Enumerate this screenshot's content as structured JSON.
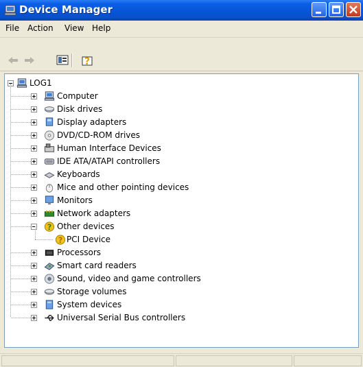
{
  "window": {
    "title": "Device Manager",
    "colors": {
      "titlebar": "#0a5fe8",
      "close": "#c3381f",
      "selection": "#316ac5"
    }
  },
  "menu": {
    "file": "File",
    "action": "Action",
    "view": "View",
    "help": "Help"
  },
  "toolbar": {
    "icons": [
      "back-arrow-icon",
      "forward-arrow-icon",
      "properties-icon",
      "help-icon"
    ]
  },
  "tree": {
    "root": "LOG1",
    "items": [
      {
        "label": "Computer",
        "icon": "computer-icon"
      },
      {
        "label": "Disk drives",
        "icon": "disk-drive-icon"
      },
      {
        "label": "Display adapters",
        "icon": "display-adapter-icon"
      },
      {
        "label": "DVD/CD-ROM drives",
        "icon": "dvd-drive-icon"
      },
      {
        "label": "Human Interface Devices",
        "icon": "hid-icon"
      },
      {
        "label": "IDE ATA/ATAPI controllers",
        "icon": "ide-controller-icon"
      },
      {
        "label": "Keyboards",
        "icon": "keyboard-icon"
      },
      {
        "label": "Mice and other pointing devices",
        "icon": "mouse-icon"
      },
      {
        "label": "Monitors",
        "icon": "monitor-icon"
      },
      {
        "label": "Network adapters",
        "icon": "network-adapter-icon"
      },
      {
        "label": "Other devices",
        "icon": "unknown-device-icon",
        "expanded": true
      },
      {
        "label": "PCI Device",
        "icon": "warning-device-icon",
        "child": true
      },
      {
        "label": "Processors",
        "icon": "processor-icon"
      },
      {
        "label": "Smart card readers",
        "icon": "smart-card-icon"
      },
      {
        "label": "Sound, video and game controllers",
        "icon": "sound-icon"
      },
      {
        "label": "Storage volumes",
        "icon": "storage-icon"
      },
      {
        "label": "System devices",
        "icon": "system-device-icon"
      },
      {
        "label": "Universal Serial Bus controllers",
        "icon": "usb-icon"
      }
    ]
  }
}
